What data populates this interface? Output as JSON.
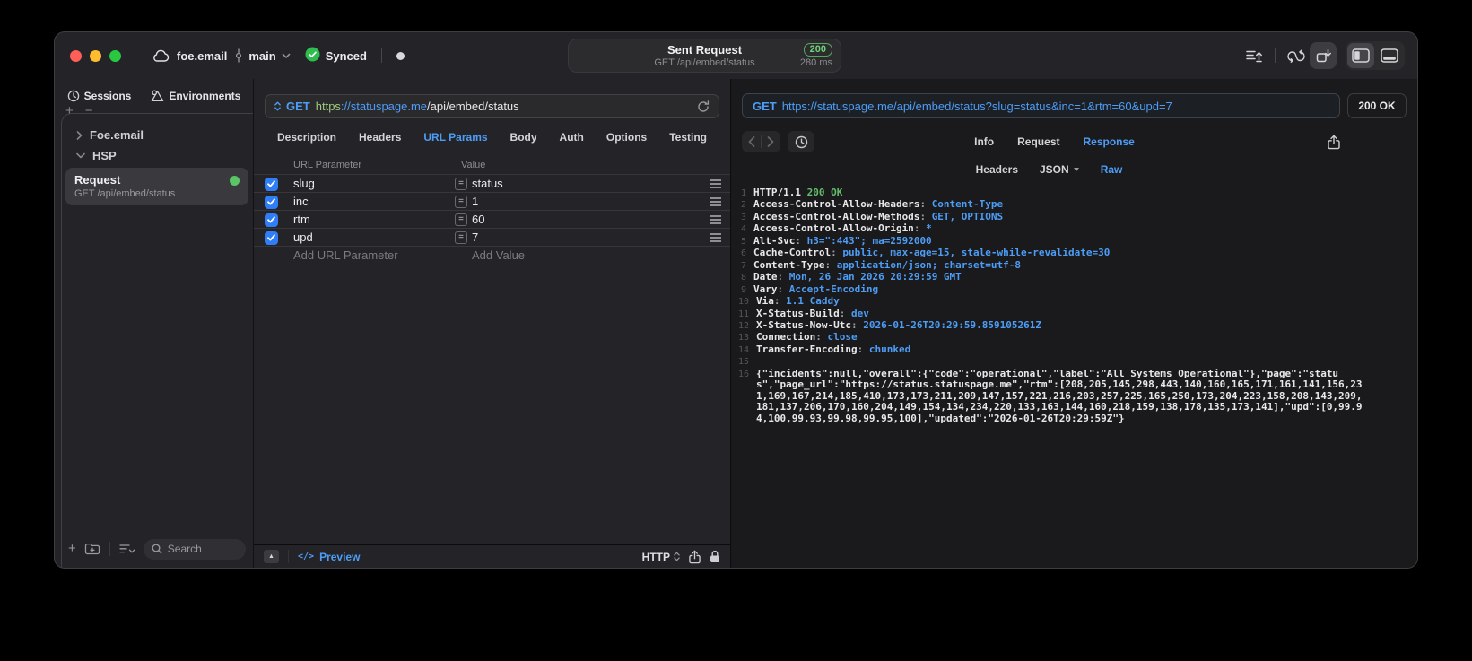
{
  "titlebar": {
    "project": "foe.email",
    "branch": "main",
    "sync_label": "Synced",
    "request_summary": {
      "title": "Sent Request",
      "subtitle": "GET /api/embed/status",
      "status_code": "200",
      "duration": "280 ms"
    }
  },
  "sidebar": {
    "tabs": [
      {
        "label": "Sessions",
        "icon": "history-clock-icon"
      },
      {
        "label": "Environments",
        "icon": "environments-icon"
      }
    ],
    "tree": [
      {
        "label": "Foe.email",
        "expanded": false
      },
      {
        "label": "HSP",
        "expanded": true
      }
    ],
    "request_item": {
      "title": "Request",
      "subtitle": "GET /api/embed/status",
      "status_color": "#5BC466"
    },
    "search": {
      "placeholder": "Search"
    }
  },
  "request_editor": {
    "method": "GET",
    "url": {
      "scheme": "https",
      "host": "://statuspage.me",
      "path": "/api/embed/status"
    },
    "tabs": [
      "Description",
      "Headers",
      "URL Params",
      "Body",
      "Auth",
      "Options",
      "Testing"
    ],
    "active_tab": "URL Params",
    "params": {
      "columns": [
        "URL Parameter",
        "Value"
      ],
      "rows": [
        {
          "enabled": true,
          "name": "slug",
          "value": "status"
        },
        {
          "enabled": true,
          "name": "inc",
          "value": "1"
        },
        {
          "enabled": true,
          "name": "rtm",
          "value": "60"
        },
        {
          "enabled": true,
          "name": "upd",
          "value": "7"
        }
      ],
      "add_parameter_placeholder": "Add URL Parameter",
      "add_value_placeholder": "Add Value"
    },
    "footer": {
      "preview_label": "Preview",
      "protocol_label": "HTTP"
    }
  },
  "response_viewer": {
    "request_line": {
      "method": "GET",
      "url": "https://statuspage.me/api/embed/status?slug=status&inc=1&rtm=60&upd=7"
    },
    "status_badge": "200 OK",
    "tabs": [
      "Info",
      "Request",
      "Response"
    ],
    "active_tab": "Response",
    "subtabs": [
      "Headers",
      "JSON",
      "Raw"
    ],
    "active_subtab": "Raw",
    "raw": {
      "status_line": {
        "protocol": "HTTP/1.1",
        "status": "200 OK"
      },
      "headers": [
        {
          "name": "Access-Control-Allow-Headers",
          "value": "Content-Type"
        },
        {
          "name": "Access-Control-Allow-Methods",
          "value": "GET, OPTIONS"
        },
        {
          "name": "Access-Control-Allow-Origin",
          "value": "*"
        },
        {
          "name": "Alt-Svc",
          "value": "h3=\":443\"; ma=2592000"
        },
        {
          "name": "Cache-Control",
          "value": "public, max-age=15, stale-while-revalidate=30"
        },
        {
          "name": "Content-Type",
          "value": "application/json; charset=utf-8"
        },
        {
          "name": "Date",
          "value": "Mon, 26 Jan 2026 20:29:59 GMT"
        },
        {
          "name": "Vary",
          "value": "Accept-Encoding"
        },
        {
          "name": "Via",
          "value": "1.1 Caddy"
        },
        {
          "name": "X-Status-Build",
          "value": "dev"
        },
        {
          "name": "X-Status-Now-Utc",
          "value": "2026-01-26T20:29:59.859105261Z"
        },
        {
          "name": "Connection",
          "value": "close"
        },
        {
          "name": "Transfer-Encoding",
          "value": "chunked"
        }
      ],
      "body": "{\"incidents\":null,\"overall\":{\"code\":\"operational\",\"label\":\"All Systems Operational\"},\"page\":\"status\",\"page_url\":\"https://status.statuspage.me\",\"rtm\":[208,205,145,298,443,140,160,165,171,161,141,156,231,169,167,214,185,410,173,173,211,209,147,157,221,216,203,257,225,165,250,173,204,223,158,208,143,209,181,137,206,170,160,204,149,154,134,234,220,133,163,144,160,218,159,138,178,135,173,141],\"upd\":[0,99.94,100,99.93,99.98,99.95,100],\"updated\":\"2026-01-26T20:29:59Z\"}"
    }
  },
  "icons": {
    "plus": "+",
    "minus": "−",
    "equals": "=",
    "expand_triangle": "▲",
    "code_preview": "</>"
  },
  "colors": {
    "accent_blue": "#4D9DF6",
    "code_green": "#63BE6B",
    "checkbox_blue": "#2F7EF7",
    "status_green": "#5BC466",
    "badge_green": "#6FD37A"
  }
}
